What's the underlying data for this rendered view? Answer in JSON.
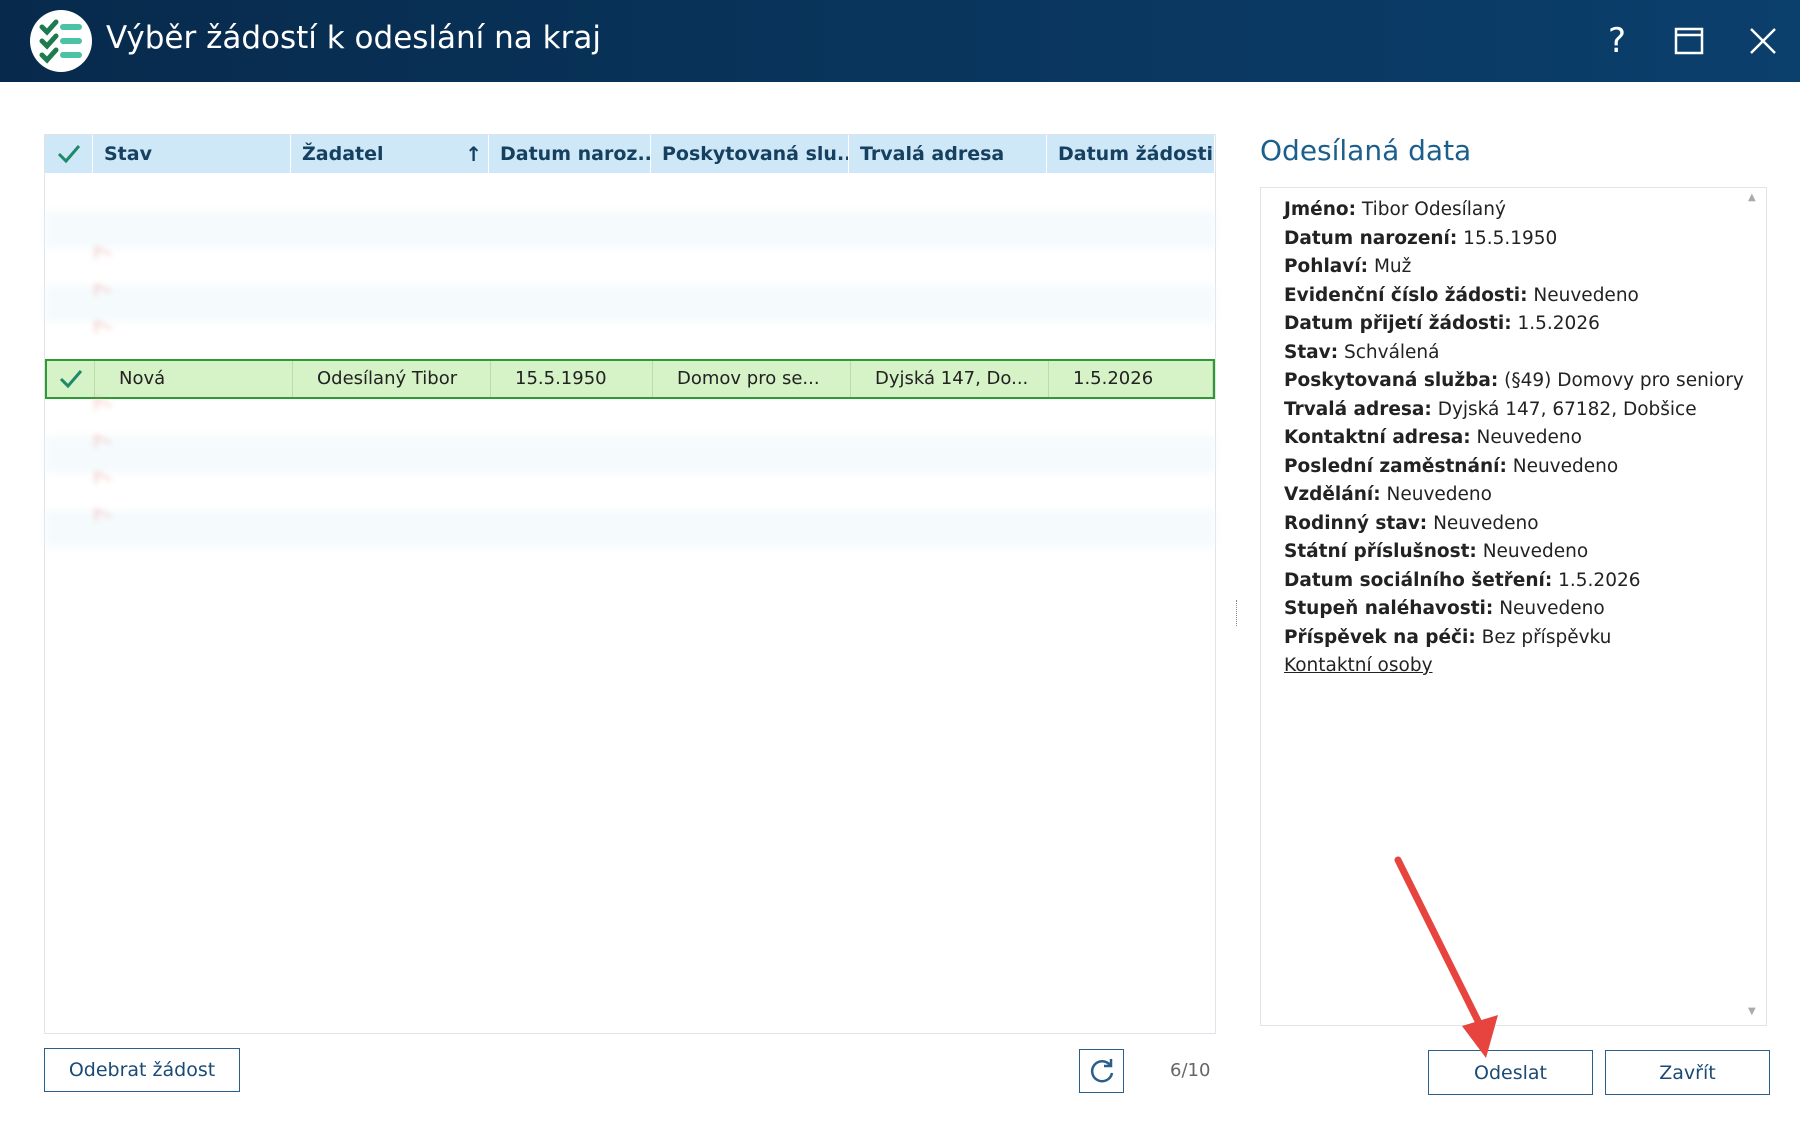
{
  "window": {
    "title": "Výběr žádostí k odeslání na kraj",
    "help_label": "?",
    "icons": {
      "help": "question-icon",
      "maximize": "maximize-icon",
      "close": "close-icon",
      "logo": "checklist-logo-icon"
    }
  },
  "table": {
    "columns": [
      "Stav",
      "Žadatel",
      "Datum naroz...",
      "Poskytovaná slu...",
      "Trvalá adresa",
      "Datum žádosti"
    ],
    "sort_icon": "↑",
    "selected_row": {
      "stav": "Nová",
      "zadatel": "Odesílaný Tibor",
      "datum_narozeni": "15.5.1950",
      "sluzba": "Domov pro se...",
      "adresa": "Dyjská 147, Do...",
      "datum_zadosti": "1.5.2026"
    },
    "accent_color": "#2e9a33"
  },
  "footer": {
    "remove_button": "Odebrat žádost",
    "counter": "6/10"
  },
  "panel": {
    "title": "Odesílaná data",
    "lines": [
      {
        "label": "Jméno:",
        "value": " Tibor Odesílaný"
      },
      {
        "label": "Datum narození:",
        "value": " 15.5.1950"
      },
      {
        "label": "Pohlaví:",
        "value": " Muž"
      },
      {
        "label": "Evidenční číslo žádosti:",
        "value": " Neuvedeno"
      },
      {
        "label": "Datum přijetí žádosti:",
        "value": " 1.5.2026"
      },
      {
        "label": "Stav:",
        "value": " Schválená"
      },
      {
        "label": "Poskytovaná služba:",
        "value": " (§49) Domovy pro seniory"
      },
      {
        "label": "Trvalá adresa:",
        "value": " Dyjská 147, 67182, Dobšice"
      },
      {
        "label": "Kontaktní adresa:",
        "value": " Neuvedeno"
      },
      {
        "label": "Poslední zaměstnání:",
        "value": " Neuvedeno"
      },
      {
        "label": "Vzdělání:",
        "value": " Neuvedeno"
      },
      {
        "label": "Rodinný stav:",
        "value": " Neuvedeno"
      },
      {
        "label": "Státní příslušnost:",
        "value": " Neuvedeno"
      },
      {
        "label": "Datum sociálního šetření:",
        "value": " 1.5.2026"
      },
      {
        "label": "Stupeň naléhavosti:",
        "value": " Neuvedeno"
      },
      {
        "label": "Příspěvek na péči:",
        "value": " Bez příspěvku"
      }
    ],
    "contacts_link": "Kontaktní osoby"
  },
  "buttons": {
    "send": "Odeslat",
    "close": "Zavřít"
  }
}
